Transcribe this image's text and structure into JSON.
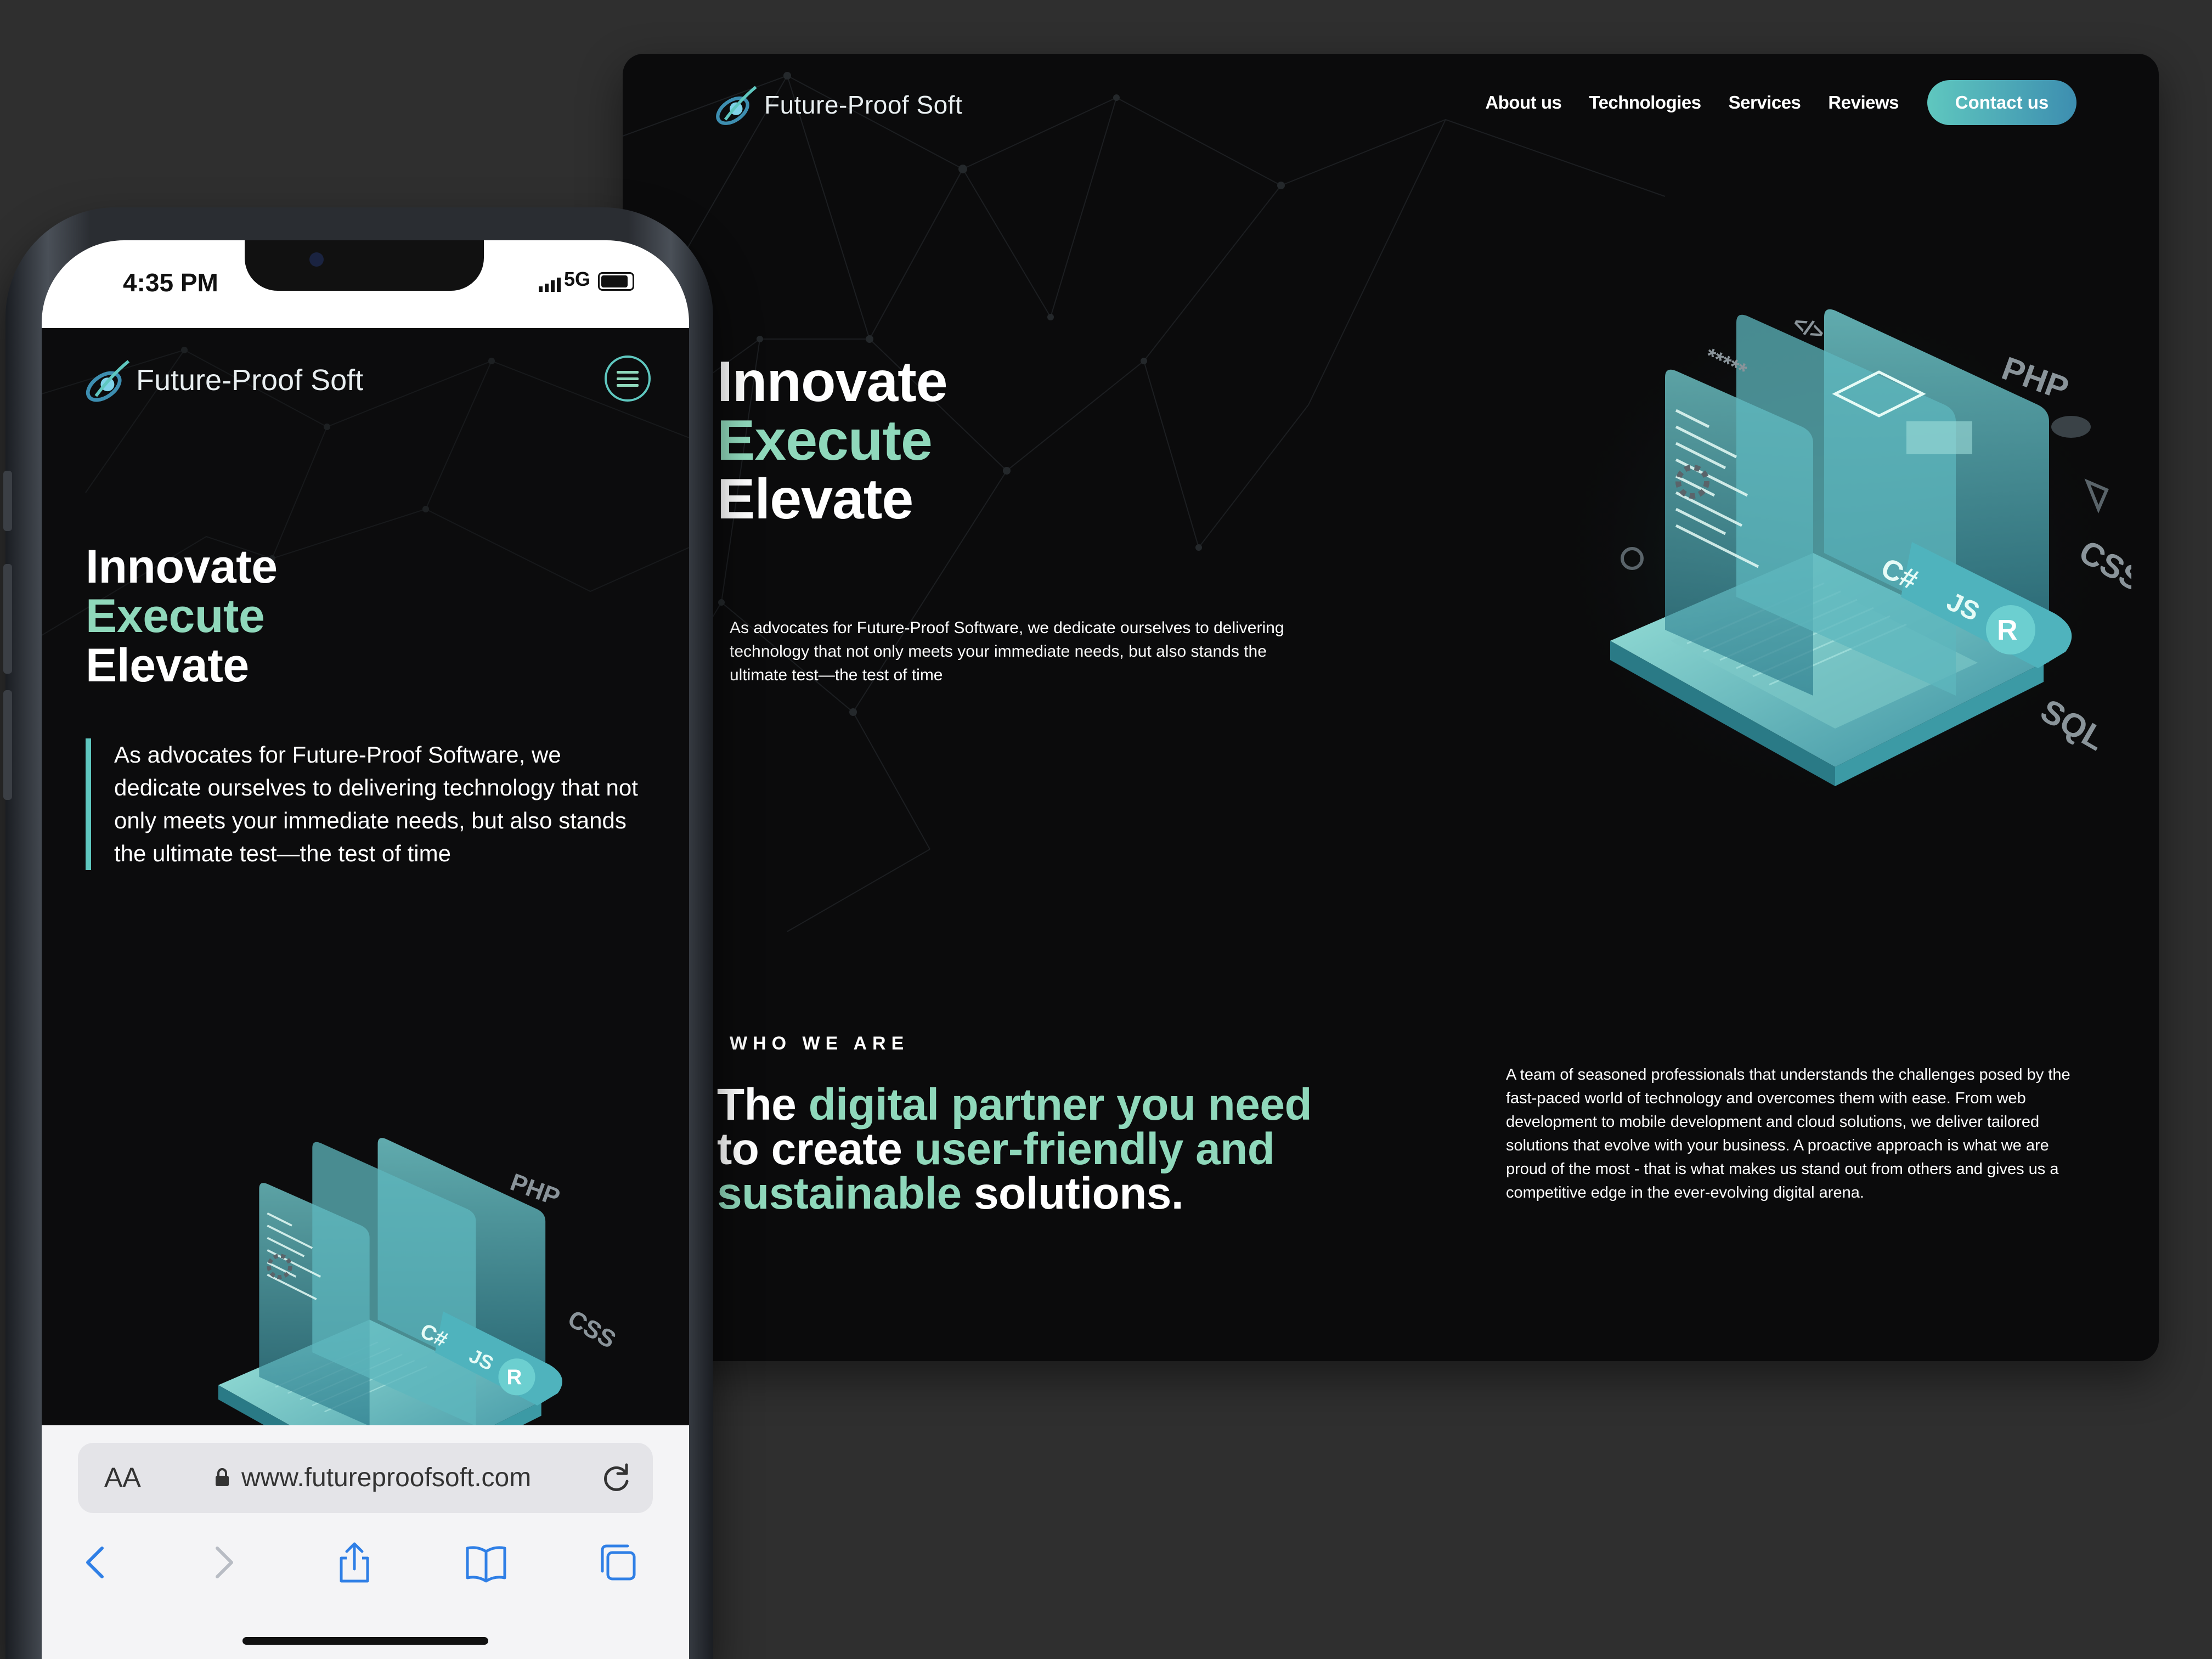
{
  "desktop": {
    "brand": "Future-Proof Soft",
    "nav": [
      "About us",
      "Technologies",
      "Services",
      "Reviews"
    ],
    "cta": "Contact us",
    "hero": [
      "Innovate",
      "Execute",
      "Elevate"
    ],
    "description": "As advocates for Future-Proof Software, we dedicate ourselves to delivering technology that not only meets your immediate needs, but also stands the ultimate test—the test of time",
    "who_label": "WHO WE ARE",
    "tagline": {
      "p1": "The ",
      "p2": "digital partner you need",
      "p3": " to create ",
      "p4": "user-friendly and sustainable",
      "p5": " solutions."
    },
    "about": "A team of seasoned professionals that understands the challenges posed by the fast-paced world of technology and overcomes them with ease. From web development to mobile development and cloud solutions, we deliver tailored solutions that evolve with your business. A proactive approach is what we are proud of the most - that is what makes us stand out from others and gives us a competitive edge in the ever-evolving digital arena.",
    "illustration_labels": [
      "PHP",
      "CSS",
      "SQL",
      "C#",
      "JS",
      "R",
      "*****",
      "</>"
    ]
  },
  "phone": {
    "time": "4:35 PM",
    "network": "5G",
    "brand": "Future-Proof Soft",
    "hero": [
      "Innovate",
      "Execute",
      "Elevate"
    ],
    "description": "As advocates for Future-Proof Software, we dedicate ourselves to delivering technology that not only meets your immediate needs, but also stands the ultimate test—the test of time",
    "browser": {
      "aa_label": "AA",
      "url": "www.futureproofsoft.com"
    }
  },
  "colors": {
    "background": "#2f2f2f",
    "page": "#0b0b0c",
    "accent": "#8fd8bb",
    "teal": "#5fc7bf",
    "blue": "#3d8eb0"
  },
  "icons": [
    "logo-icon",
    "menu-icon",
    "lock-icon",
    "reload-icon",
    "back-icon",
    "forward-icon",
    "share-icon",
    "bookmarks-icon",
    "tabs-icon"
  ]
}
